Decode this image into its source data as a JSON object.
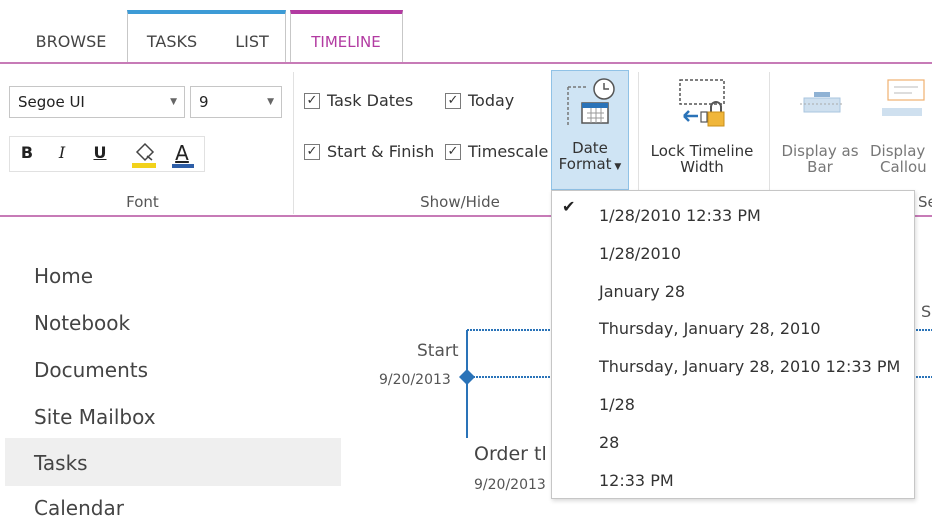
{
  "tabs": {
    "browse": "BROWSE",
    "tasks": "TASKS",
    "list": "LIST",
    "timeline": "TIMELINE"
  },
  "font_group": {
    "font_name": "Segoe UI",
    "font_size": "9",
    "bold": "B",
    "italic": "I",
    "underline": "U",
    "font_color_letter": "A",
    "label": "Font"
  },
  "show_hide": {
    "task_dates": "Task Dates",
    "today": "Today",
    "start_finish": "Start & Finish",
    "timescale": "Timescale",
    "label": "Show/Hide"
  },
  "buttons": {
    "date_format_line1": "Date",
    "date_format_line2": "Format",
    "lock_line1": "Lock Timeline",
    "lock_line2": "Width",
    "display_bar_line1": "Display as",
    "display_bar_line2": "Bar",
    "display_callout_line1": "Display",
    "display_callout_line2": "Callou",
    "next_group_label_partial": "Se"
  },
  "nav": {
    "items": [
      "Home",
      "Notebook",
      "Documents",
      "Site Mailbox",
      "Tasks",
      "Calendar"
    ],
    "selected": "Tasks"
  },
  "timeline": {
    "start_label": "Start",
    "start_date": "9/20/2013",
    "task_title": "Order tl",
    "task_date": "9/20/2013",
    "right_partial": "S"
  },
  "date_format_menu": {
    "options": [
      "1/28/2010 12:33 PM",
      "1/28/2010",
      "January 28",
      "Thursday, January 28, 2010",
      "Thursday, January 28, 2010 12:33 PM",
      "1/28",
      "28",
      "12:33 PM"
    ],
    "selected_index": 0,
    "check_mark": "✔"
  },
  "colors": {
    "tasks_accent": "#3d9bd6",
    "timeline_accent": "#b23aa1",
    "highlight_fill": "#f2d21b",
    "font_color_bar": "#2e5ea7",
    "timeline_blue": "#2a73b8"
  }
}
